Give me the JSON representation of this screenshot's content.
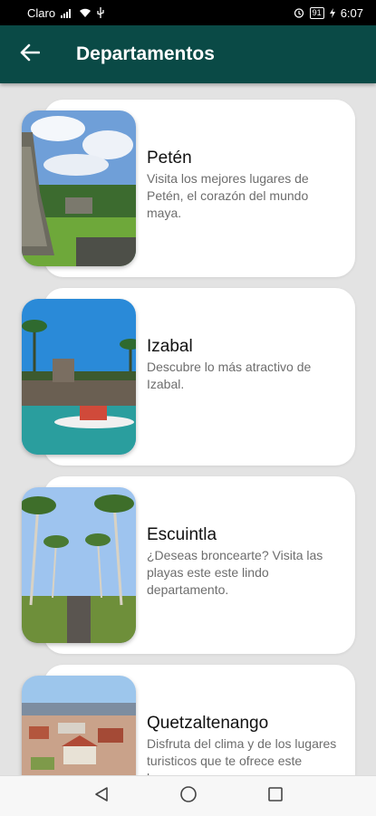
{
  "status_bar": {
    "carrier": "Claro",
    "battery": "91",
    "time": "6:07"
  },
  "app_bar": {
    "title": "Departamentos",
    "back_icon": "arrow-left-icon"
  },
  "departments": [
    {
      "title": "Petén",
      "description": "Visita los mejores lugares de Petén, el corazón del mundo maya.",
      "image": "mayan-temple-photo"
    },
    {
      "title": "Izabal",
      "description": "Descubre lo más atractivo de Izabal.",
      "image": "fortress-boat-photo"
    },
    {
      "title": "Escuintla",
      "description": "¿Deseas broncearte? Visita las playas este este lindo departamento.",
      "image": "palm-road-photo"
    },
    {
      "title": "Quetzaltenango",
      "description": "Disfruta del clima y de los lugares turisticos que te ofrece este hermoso",
      "image": "city-view-photo"
    }
  ],
  "nav_bar": {
    "back_icon": "triangle-back-icon",
    "home_icon": "circle-home-icon",
    "recents_icon": "square-recents-icon"
  }
}
